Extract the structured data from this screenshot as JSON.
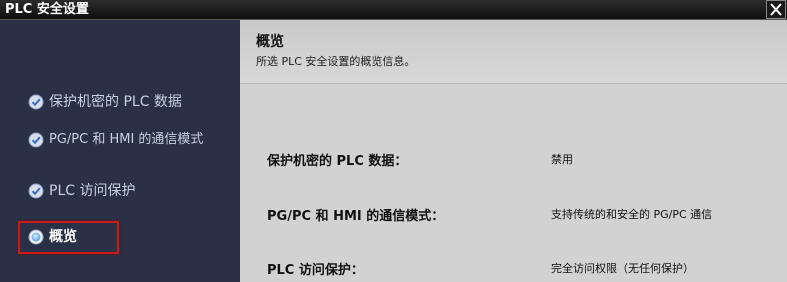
{
  "window": {
    "title": "PLC 安全设置",
    "close_icon": "close-icon"
  },
  "sidebar": {
    "items": [
      {
        "label": "保护机密的 PLC 数据",
        "icon": "check-circle-icon",
        "state": "done"
      },
      {
        "label": "PG/PC 和 HMI 的通信模式",
        "icon": "check-circle-icon",
        "state": "done"
      },
      {
        "label": "PLC 访问保护",
        "icon": "check-circle-icon",
        "state": "done"
      },
      {
        "label": "概览",
        "icon": "current-step-icon",
        "state": "active"
      }
    ]
  },
  "header": {
    "title": "概览",
    "subtitle": "所选 PLC 安全设置的概览信息。"
  },
  "summary": {
    "rows": [
      {
        "label": "保护机密的 PLC 数据：",
        "value": "禁用"
      },
      {
        "label": "PG/PC 和 HMI 的通信模式：",
        "value": "支持传统的和安全的 PG/PC 通信"
      },
      {
        "label": "PLC 访问保护：",
        "value": "完全访问权限（无任何保护）"
      }
    ]
  },
  "colors": {
    "highlight_border": "#cc1a1a",
    "sidebar_bg": "#2a3046",
    "content_bg": "#d2d2d2"
  }
}
